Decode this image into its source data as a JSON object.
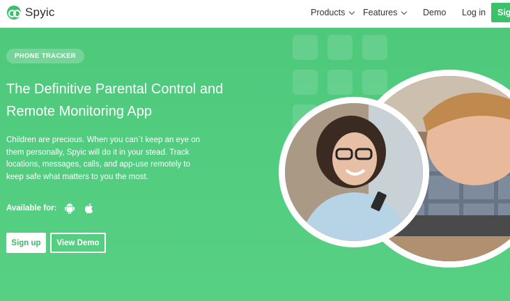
{
  "nav": {
    "brand": "Spyic",
    "items": [
      {
        "label": "Products",
        "has_dropdown": true
      },
      {
        "label": "Features",
        "has_dropdown": true
      },
      {
        "label": "Demo",
        "has_dropdown": false
      },
      {
        "label": "Log in",
        "has_dropdown": false
      }
    ],
    "signup_label": "Sig"
  },
  "hero": {
    "badge": "PHONE TRACKER",
    "headline_line1": "The Definitive Parental Control and",
    "headline_line2": "Remote Monitoring App",
    "description": "Children are precious. When you can`t keep an eye on them personally, Spyic will do it in your stead. Track locations, messages, calls, and app-use remotely to keep safe what matters to you the most.",
    "available_label": "Available for:",
    "platform_icons": [
      "android-icon",
      "apple-icon"
    ],
    "signup_button": "Sign up",
    "demo_button": "View Demo"
  },
  "colors": {
    "brand_green": "#3cc16b",
    "hero_green": "#56cf82"
  }
}
